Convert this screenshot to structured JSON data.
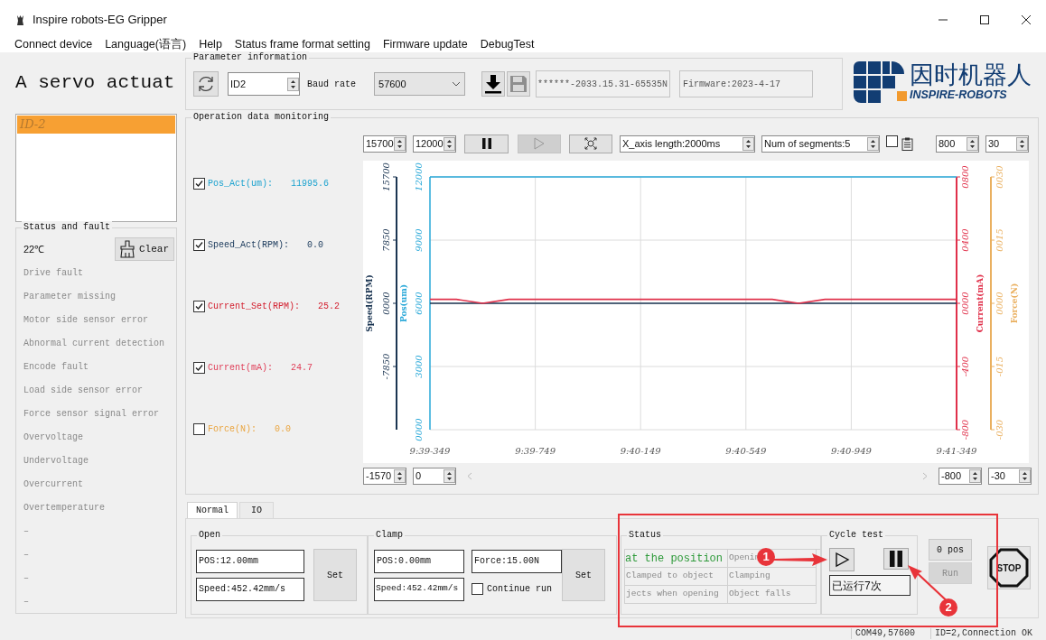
{
  "window": {
    "title": "Inspire robots-EG Gripper"
  },
  "menu": [
    "Connect device",
    "Language(语言)",
    "Help",
    "Status frame format setting",
    "Firmware update",
    "DebugTest"
  ],
  "header": "A servo actuat",
  "devices": [
    {
      "label": "ID-2",
      "selected": true
    }
  ],
  "status_fault": {
    "title": "Status and fault",
    "temperature": "22℃",
    "clear": "Clear",
    "faults": [
      "Drive fault",
      "Parameter missing",
      "Motor side sensor error",
      "Abnormal current detection",
      "Encode fault",
      "Load side sensor error",
      "Force sensor signal error",
      "Overvoltage",
      "Undervoltage",
      "Overcurrent",
      "Overtemperature",
      "–",
      "–",
      "–",
      "–"
    ]
  },
  "parameters": {
    "title": "Parameter information",
    "id": "ID2",
    "baud_label": "Baud rate",
    "baud": "57600",
    "serial": "******-2033.15.31-65535N",
    "firmware": "Firmware:2023-4-17"
  },
  "logo": {
    "cn": "因时机器人",
    "en": "INSPIRE-ROBOTS"
  },
  "monitor": {
    "title": "Operation data monitoring",
    "signals": [
      {
        "label": "Pos_Act(um):",
        "value": "11995.6",
        "checked": true,
        "color": "#1ea3cf"
      },
      {
        "label": "Speed_Act(RPM):",
        "value": "0.0",
        "checked": true,
        "color": "#1b3a5c"
      },
      {
        "label": "Current_Set(RPM):",
        "value": "25.2",
        "checked": true,
        "color": "#d3202f"
      },
      {
        "label": "Current(mA):",
        "value": "24.7",
        "checked": true,
        "color": "#e0405a"
      },
      {
        "label": "Force(N):",
        "value": "0.0",
        "checked": false,
        "color": "#eaa540"
      }
    ],
    "toolbar": {
      "spin_1": "15700",
      "spin_2": "12000",
      "playing": true,
      "x_axis_length": "X_axis length:2000ms",
      "segments": "Num of segments:5",
      "option_checked": false,
      "spin_3": "800",
      "spin_4": "30"
    },
    "bottom": {
      "spin_1": "-1570",
      "spin_2": "0",
      "spin_3": "-800",
      "spin_4": "-30"
    },
    "force_axis": {
      "title": "Force(N)",
      "color": "#eab060",
      "ticks": [
        "0030",
        "0015",
        "0000",
        "-015",
        "-030"
      ]
    },
    "chart_data": {
      "type": "line",
      "grid": true,
      "ylabel": "Pos(um)",
      "y2label": "Speed(RPM)",
      "y3label": "Current(mA)",
      "categories": [
        "9:39-349",
        null,
        null,
        null,
        "9:39-749",
        null,
        null,
        null,
        "9:40-149",
        null,
        null,
        null,
        "9:40-549",
        null,
        null,
        null,
        "9:40-949",
        null,
        null,
        null,
        "9:41-349"
      ],
      "ylim": [
        0,
        12000
      ],
      "yticks": [
        {
          "value": 0,
          "label": "0000"
        },
        {
          "value": 3000,
          "label": "3000"
        },
        {
          "value": 6000,
          "label": "6000"
        },
        {
          "value": 9000,
          "label": "9000"
        },
        {
          "value": 12000,
          "label": "12000"
        }
      ],
      "y2lim": [
        -15700,
        15700
      ],
      "y2ticks": [
        {
          "value": 15700,
          "label": "15700"
        },
        {
          "value": 7850,
          "label": "7850"
        },
        {
          "value": 0,
          "label": "0000"
        },
        {
          "value": -7850,
          "label": "-7850"
        }
      ],
      "y3lim": [
        -800,
        800
      ],
      "y3ticks": [
        {
          "value": 800,
          "label": "0800"
        },
        {
          "value": 400,
          "label": "0400"
        },
        {
          "value": 0,
          "label": "0000"
        },
        {
          "value": -400,
          "label": "-400"
        },
        {
          "value": -800,
          "label": "-800"
        }
      ],
      "series": [
        {
          "color": "#29a8d8",
          "values": [
            12000,
            12000,
            12000,
            12000,
            12000,
            12000,
            12000,
            12000,
            12000,
            12000,
            12000,
            12000,
            12000,
            12000,
            12000,
            12000,
            12000,
            12000,
            12000,
            12000,
            12000
          ]
        },
        {
          "color": "#1b3552",
          "axis": "y2",
          "values": [
            0,
            0,
            0,
            0,
            0,
            0,
            0,
            0,
            0,
            0,
            0,
            0,
            0,
            0,
            0,
            0,
            0,
            0,
            0,
            0,
            0
          ]
        },
        {
          "color": "#e0304a",
          "axis": "y3",
          "values": [
            25,
            25,
            0,
            25,
            25,
            25,
            25,
            25,
            25,
            25,
            25,
            25,
            25,
            25,
            0,
            25,
            25,
            25,
            25,
            25,
            25
          ]
        }
      ]
    }
  },
  "tabs": [
    {
      "label": "Normal",
      "selected": true
    },
    {
      "label": "IO",
      "selected": false
    }
  ],
  "open": {
    "title": "Open",
    "pos": "POS:12.00mm",
    "speed": "Speed:452.42mm/s",
    "button": "Set"
  },
  "clamp": {
    "title": "Clamp",
    "pos": "POS:0.00mm",
    "force": "Force:15.00N",
    "speed": "Speed:452.42mm/s",
    "continue_run": {
      "label": "Continue run",
      "checked": false
    },
    "button": "Set"
  },
  "status": {
    "title": "Status",
    "cells": [
      {
        "label": "at the position",
        "active": true
      },
      {
        "label": "Openin",
        "active": false
      },
      {
        "label": "Clamped to object",
        "active": false
      },
      {
        "label": "Clamping",
        "active": false
      },
      {
        "label": "jects when opening",
        "active": false
      },
      {
        "label": "Object falls",
        "active": false
      }
    ]
  },
  "cycle_test": {
    "title": "Cycle test",
    "count": "已运行7次"
  },
  "zero_pos": "0 pos",
  "run": {
    "label": "Run",
    "disabled": true
  },
  "stop": "STOP",
  "annotations": [
    {
      "label": "1"
    },
    {
      "label": "2"
    }
  ],
  "status_bar": [
    "COM49,57600",
    "ID=2,Connection OK"
  ]
}
